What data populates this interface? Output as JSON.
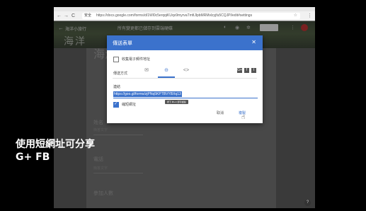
{
  "browser": {
    "nav_back": "←",
    "nav_forward": "→",
    "nav_reload": "C",
    "secure_label": "安全",
    "url": "https://docs.google.com/forms/d/1Wl0c5erqqiKUqv9myrvaTmfiJlpbMRMvlzyjfu5CQJPl/edit#settings",
    "star": "☆",
    "menu": "⋮"
  },
  "header": {
    "back": "←",
    "title": "海洋小旅行",
    "banner_text": "海洋",
    "mid_text": "所有變更都已儲存到雲端硬碟",
    "send_label": "傳送"
  },
  "background_form": {
    "title": "海洋",
    "fields": [
      {
        "label": "姓名",
        "sub": "簡答文字"
      },
      {
        "label": "電話",
        "sub": "簡答文字"
      },
      {
        "label": "參加人數",
        "sub": ""
      }
    ]
  },
  "dialog": {
    "title": "傳送表單",
    "close": "✕",
    "collect_email": "收集電子郵件地址",
    "send_via": "傳送方式",
    "tab_email": "✉",
    "tab_link": "⊝",
    "tab_embed": "<>",
    "social": [
      "G+",
      "f",
      "t"
    ],
    "link_label": "連結",
    "link_value": "https://goo.gl/forms/zjPNq5KPTBVYBXq13",
    "tooltip": "按下 ⌘+C 即可複製",
    "shorten_label": "縮短網址",
    "cancel": "取消",
    "copy": "複製"
  },
  "caption": {
    "line1": "使用短網址可分享",
    "line2": "G+ FB"
  },
  "colors": {
    "accent": "#3b72cc"
  }
}
